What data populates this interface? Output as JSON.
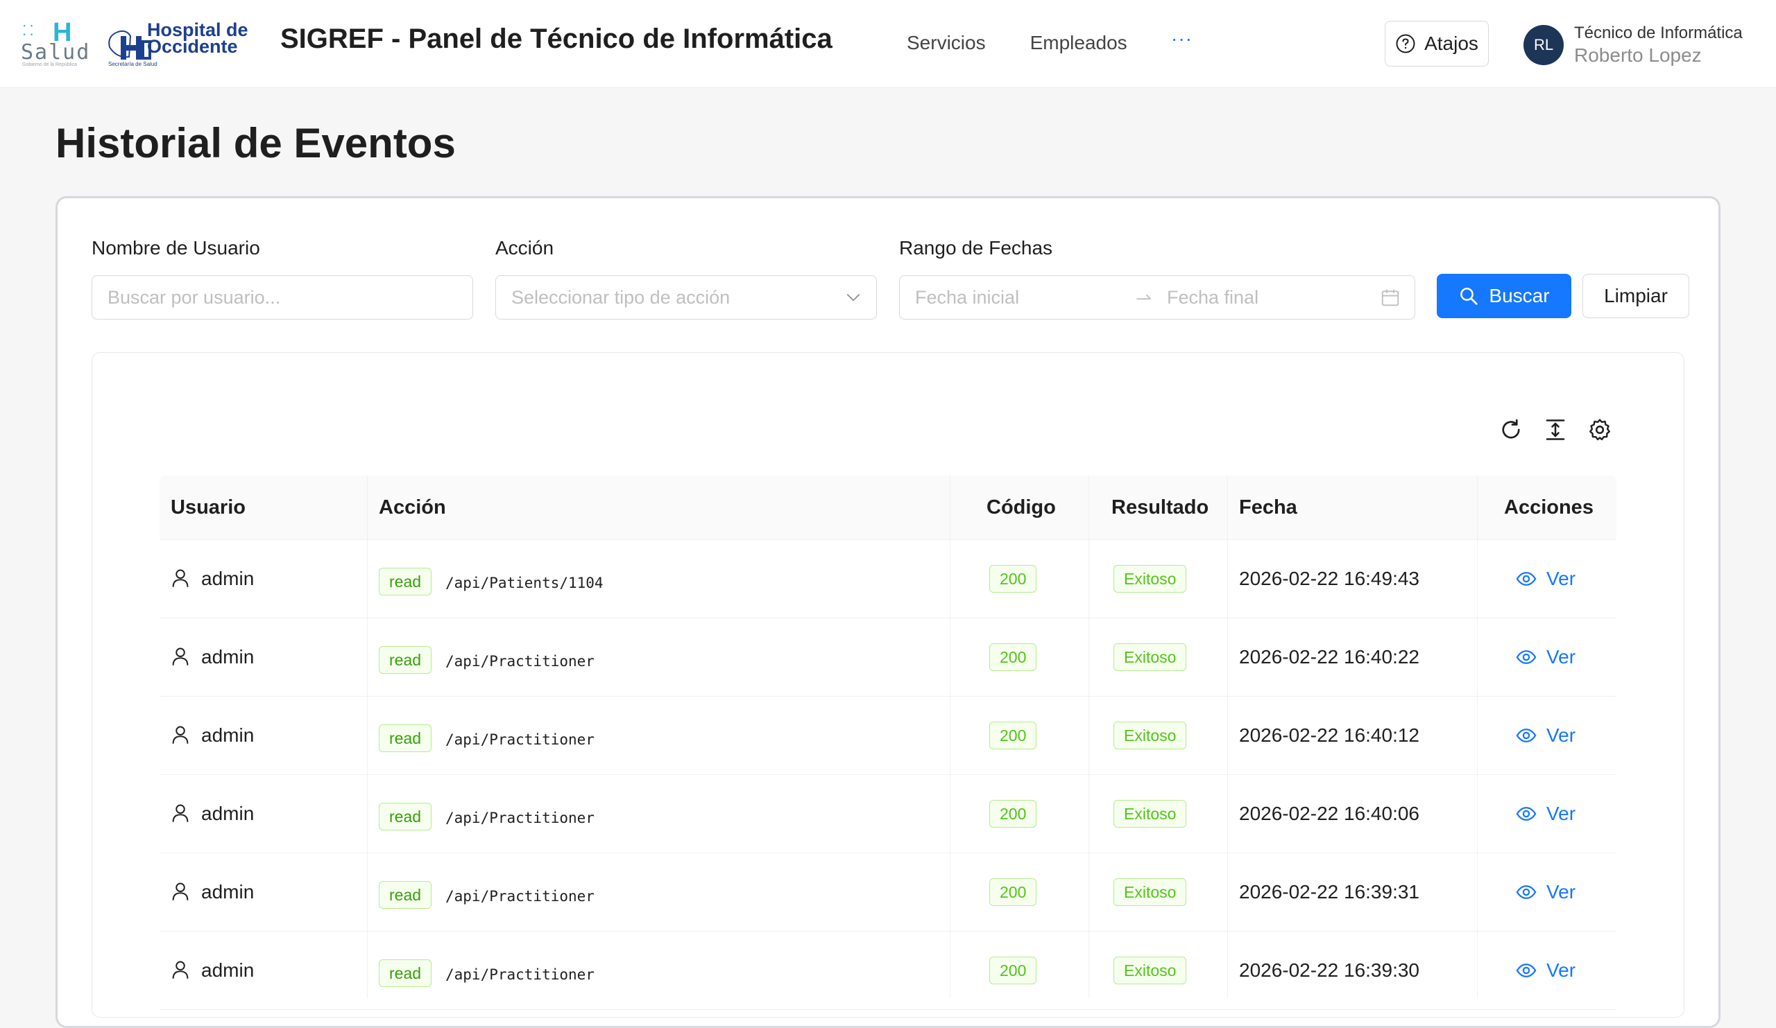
{
  "header": {
    "logo_salud": {
      "mark": "H",
      "word": "Salud",
      "sub": "Gobierno de la República"
    },
    "logo_hospital": {
      "line1": "Hospital de",
      "line2": "Occidente",
      "sub": "Secretaría de Salud"
    },
    "title": "SIGREF - Panel de Técnico de Informática",
    "nav": [
      {
        "label": "Servicios"
      },
      {
        "label": "Empleados"
      }
    ],
    "more": "···",
    "shortcuts_label": "Atajos",
    "user": {
      "initials": "RL",
      "role": "Técnico de Informática",
      "name": "Roberto Lopez"
    }
  },
  "page": {
    "title": "Historial de Eventos"
  },
  "filters": {
    "user_label": "Nombre de Usuario",
    "user_placeholder": "Buscar por usuario...",
    "action_label": "Acción",
    "action_placeholder": "Seleccionar tipo de acción",
    "date_label": "Rango de Fechas",
    "date_start_placeholder": "Fecha inicial",
    "date_end_placeholder": "Fecha final",
    "search_button": "Buscar",
    "clear_button": "Limpiar"
  },
  "table": {
    "columns": [
      "Usuario",
      "Acción",
      "Código",
      "Resultado",
      "Fecha",
      "Acciones"
    ],
    "view_label": "Ver",
    "rows": [
      {
        "user": "admin",
        "action": "read",
        "path": "/api/Patients/1104",
        "code": "200",
        "result": "Exitoso",
        "date": "2026-02-22 16:49:43"
      },
      {
        "user": "admin",
        "action": "read",
        "path": "/api/Practitioner",
        "code": "200",
        "result": "Exitoso",
        "date": "2026-02-22 16:40:22"
      },
      {
        "user": "admin",
        "action": "read",
        "path": "/api/Practitioner",
        "code": "200",
        "result": "Exitoso",
        "date": "2026-02-22 16:40:12"
      },
      {
        "user": "admin",
        "action": "read",
        "path": "/api/Practitioner",
        "code": "200",
        "result": "Exitoso",
        "date": "2026-02-22 16:40:06"
      },
      {
        "user": "admin",
        "action": "read",
        "path": "/api/Practitioner",
        "code": "200",
        "result": "Exitoso",
        "date": "2026-02-22 16:39:31"
      },
      {
        "user": "admin",
        "action": "read",
        "path": "/api/Practitioner",
        "code": "200",
        "result": "Exitoso",
        "date": "2026-02-22 16:39:30"
      }
    ]
  },
  "colors": {
    "primary": "#1677ff",
    "success_text": "#52c41a",
    "success_bg": "#f6ffed",
    "success_border": "#b7eb8f",
    "brand_blue": "#1d3f8f",
    "avatar_bg": "#1d3557"
  },
  "icons": {
    "help": "question-circle-icon",
    "search": "search-icon",
    "calendar": "calendar-icon",
    "reload": "reload-icon",
    "density": "column-height-icon",
    "settings": "setting-icon",
    "user": "user-icon",
    "view": "eye-icon"
  }
}
